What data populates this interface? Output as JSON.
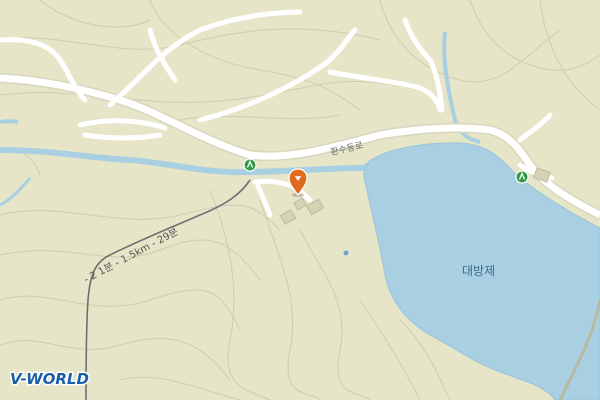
{
  "map": {
    "labels": {
      "road_name": "환수동로",
      "reservoir_name": "대방제",
      "route_distance": "- 2 1분 - 1.5km - 29분"
    },
    "logo": {
      "text": "V-WORLD"
    },
    "colors": {
      "land": "#e6e5c8",
      "water": "#a9cfe3",
      "road": "#ffffff",
      "contour": "#cfccb0",
      "trail": "#6f6f6f",
      "poi_marker": "#e06b1f",
      "poi_green": "#2e9a44",
      "logo_blue": "#1a5ea8"
    },
    "icons": [
      "location-pin-icon",
      "parking-icon",
      "parking-icon"
    ]
  }
}
